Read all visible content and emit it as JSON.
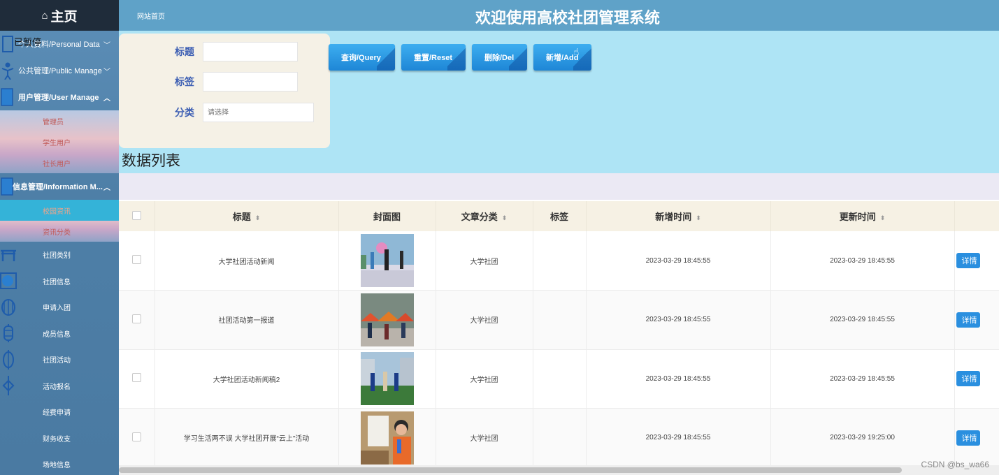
{
  "sidebar": {
    "home": "主页",
    "paused": "已暂停",
    "items": [
      {
        "label": "个人资料/Personal Data",
        "arrow": "﹀"
      },
      {
        "label": "公共管理/Public Manage",
        "arrow": "﹀"
      },
      {
        "label": "用户管理/User Manage",
        "arrow": "︿"
      }
    ],
    "user_subs": [
      "管理员",
      "学生用户",
      "社长用户"
    ],
    "info_group": {
      "label": "信息管理/Information M...",
      "arrow": "︿"
    },
    "info_subs": [
      "校园资讯",
      "资讯分类"
    ],
    "leaves": [
      "社团类别",
      "社团信息",
      "申请入团",
      "成员信息",
      "社团活动",
      "活动报名",
      "经费申请",
      "财务收支",
      "场地信息"
    ]
  },
  "topbar": {
    "crumb": "网站首页",
    "title": "欢迎使用高校社团管理系统"
  },
  "search": {
    "title_label": "标题",
    "tag_label": "标签",
    "category_label": "分类",
    "category_placeholder": "请选择",
    "buttons": {
      "query": "查询/Query",
      "reset": "重置/Reset",
      "delete": "删除/Del",
      "add": "新增/Add"
    }
  },
  "list_title": "数据列表",
  "table": {
    "headers": [
      "标题",
      "封面图",
      "文章分类",
      "标签",
      "新增时间",
      "更新时间"
    ],
    "rows": [
      {
        "title": "大学社团活动新闻",
        "category": "大学社团",
        "tag": "",
        "created": "2023-03-29 18:45:55",
        "updated": "2023-03-29 18:45:55",
        "action": "详情"
      },
      {
        "title": "社团活动第一报道",
        "category": "大学社团",
        "tag": "",
        "created": "2023-03-29 18:45:55",
        "updated": "2023-03-29 18:45:55",
        "action": "详情"
      },
      {
        "title": "大学社团活动新闻稿2",
        "category": "大学社团",
        "tag": "",
        "created": "2023-03-29 18:45:55",
        "updated": "2023-03-29 18:45:55",
        "action": "详情"
      },
      {
        "title": "学习生活两不误 大学社团开展“云上”活动",
        "category": "大学社团",
        "tag": "",
        "created": "2023-03-29 18:45:55",
        "updated": "2023-03-29 19:25:00",
        "action": "详情"
      }
    ]
  },
  "watermark": "CSDN @bs_wa66"
}
